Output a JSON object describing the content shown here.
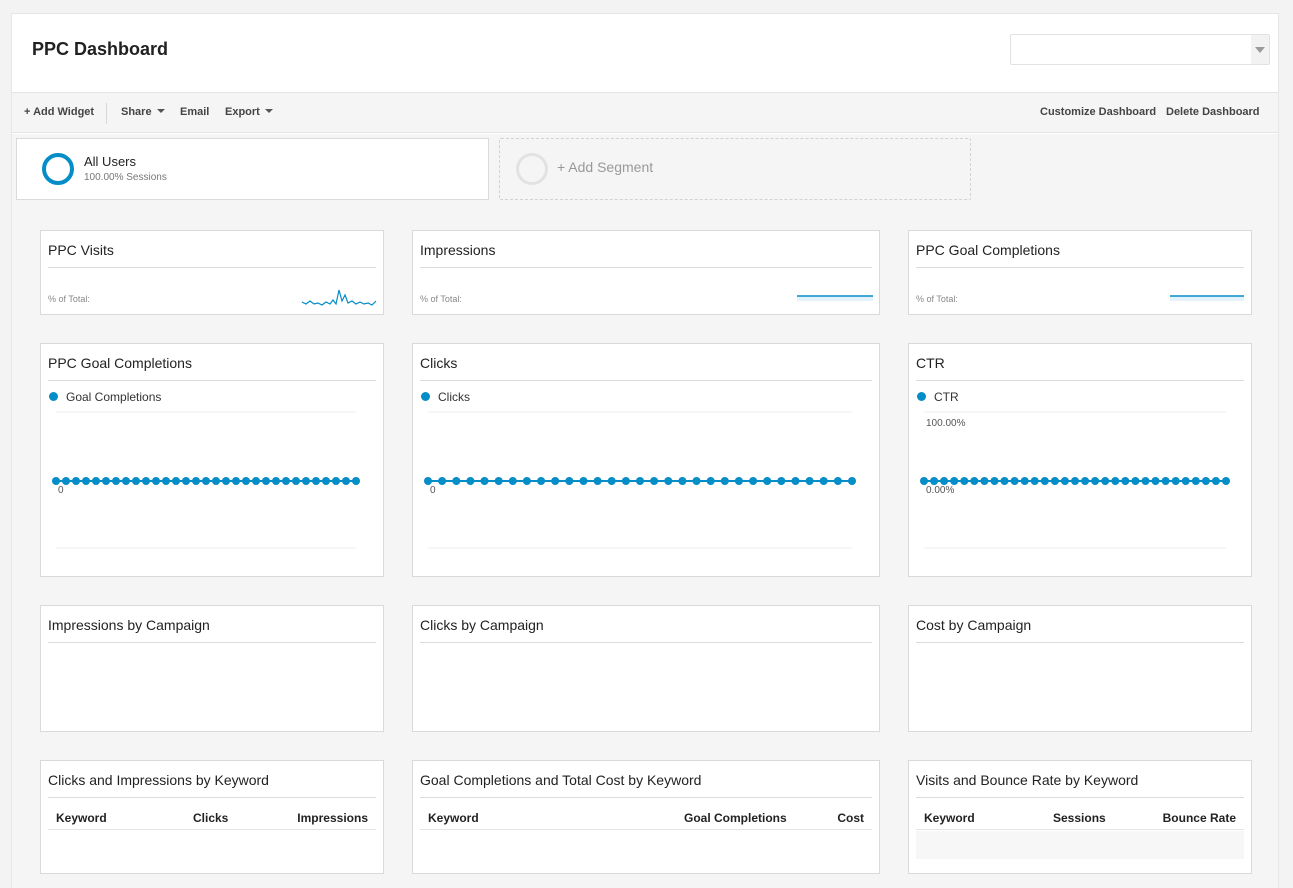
{
  "header": {
    "title": "PPC Dashboard",
    "property_select_value": ""
  },
  "toolbar": {
    "add_widget": "+ Add Widget",
    "share": "Share",
    "email": "Email",
    "export": "Export",
    "customize": "Customize Dashboard",
    "delete": "Delete Dashboard"
  },
  "segments": {
    "all_users": {
      "name": "All Users",
      "sub": "100.00% Sessions"
    },
    "add_segment": "+ Add Segment"
  },
  "colors": {
    "accent": "#058dc7",
    "spark_light": "#50b4e6"
  },
  "scorecards": [
    {
      "title": "PPC Visits",
      "pct_label": "% of Total:"
    },
    {
      "title": "Impressions",
      "pct_label": "% of Total:"
    },
    {
      "title": "PPC Goal Completions",
      "pct_label": "% of Total:"
    }
  ],
  "charts": [
    {
      "title": "PPC Goal Completions",
      "legend": "Goal Completions",
      "ytop": "",
      "ybottom": "0"
    },
    {
      "title": "Clicks",
      "legend": "Clicks",
      "ytop": "",
      "ybottom": "0"
    },
    {
      "title": "CTR",
      "legend": "CTR",
      "ytop": "100.00%",
      "ybottom": "0.00%"
    }
  ],
  "campaign_widgets": [
    {
      "title": "Impressions by Campaign"
    },
    {
      "title": "Clicks by Campaign"
    },
    {
      "title": "Cost by Campaign"
    }
  ],
  "tables": [
    {
      "title": "Clicks and Impressions by Keyword",
      "columns": [
        "Keyword",
        "Clicks",
        "Impressions"
      ]
    },
    {
      "title": "Goal Completions and Total Cost by Keyword",
      "columns": [
        "Keyword",
        "Goal Completions",
        "Cost"
      ]
    },
    {
      "title": "Visits and Bounce Rate by Keyword",
      "columns": [
        "Keyword",
        "Sessions",
        "Bounce Rate"
      ]
    }
  ],
  "chart_data": [
    {
      "type": "line",
      "title": "PPC Goal Completions",
      "series": [
        {
          "name": "Goal Completions",
          "values": [
            0,
            0,
            0,
            0,
            0,
            0,
            0,
            0,
            0,
            0,
            0,
            0,
            0,
            0,
            0,
            0,
            0,
            0,
            0,
            0,
            0,
            0,
            0,
            0,
            0,
            0,
            0,
            0,
            0,
            0,
            0
          ]
        }
      ],
      "ylim": [
        0,
        0
      ]
    },
    {
      "type": "line",
      "title": "Clicks",
      "series": [
        {
          "name": "Clicks",
          "values": [
            0,
            0,
            0,
            0,
            0,
            0,
            0,
            0,
            0,
            0,
            0,
            0,
            0,
            0,
            0,
            0,
            0,
            0,
            0,
            0,
            0,
            0,
            0,
            0,
            0,
            0,
            0,
            0,
            0,
            0,
            0
          ]
        }
      ],
      "ylim": [
        0,
        0
      ]
    },
    {
      "type": "line",
      "title": "CTR",
      "series": [
        {
          "name": "CTR",
          "values": [
            0,
            0,
            0,
            0,
            0,
            0,
            0,
            0,
            0,
            0,
            0,
            0,
            0,
            0,
            0,
            0,
            0,
            0,
            0,
            0,
            0,
            0,
            0,
            0,
            0,
            0,
            0,
            0,
            0,
            0,
            0
          ]
        }
      ],
      "ylim": [
        0,
        100
      ]
    }
  ]
}
